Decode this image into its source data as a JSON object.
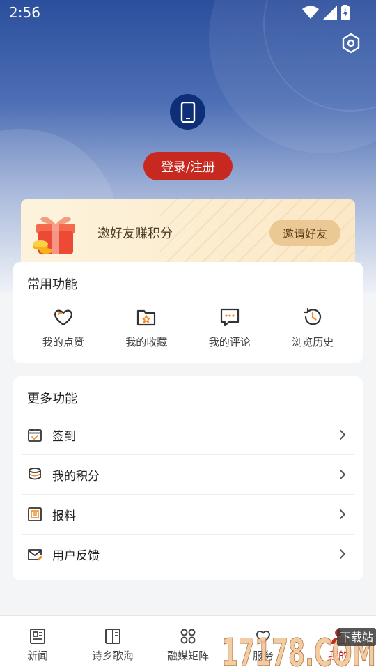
{
  "status_bar": {
    "time": "2:56"
  },
  "profile": {
    "login_label": "登录/注册"
  },
  "invite": {
    "text": "邀好友赚积分",
    "button_label": "邀请好友"
  },
  "common_functions": {
    "title": "常用功能",
    "items": [
      {
        "label": "我的点赞",
        "icon": "heart-icon"
      },
      {
        "label": "我的收藏",
        "icon": "star-folder-icon"
      },
      {
        "label": "我的评论",
        "icon": "comment-icon"
      },
      {
        "label": "浏览历史",
        "icon": "history-icon"
      }
    ]
  },
  "more_functions": {
    "title": "更多功能",
    "items": [
      {
        "label": "签到",
        "icon": "calendar-check-icon"
      },
      {
        "label": "我的积分",
        "icon": "coins-icon"
      },
      {
        "label": "报料",
        "icon": "report-icon"
      },
      {
        "label": "用户反馈",
        "icon": "mail-edit-icon"
      }
    ]
  },
  "tabbar": {
    "tabs": [
      {
        "label": "新闻",
        "icon": "news-icon"
      },
      {
        "label": "诗乡歌海",
        "icon": "book-icon"
      },
      {
        "label": "融媒矩阵",
        "icon": "grid-icon"
      },
      {
        "label": "服务",
        "icon": "service-icon"
      },
      {
        "label": "我的",
        "icon": "profile-icon"
      }
    ],
    "active_index": 4
  },
  "watermark": {
    "text": "17178.COM",
    "badge": "下载站"
  },
  "colors": {
    "brand_red": "#c7281f",
    "hero_blue": "#2c4f9d",
    "invite_gold": "#ecc895"
  }
}
